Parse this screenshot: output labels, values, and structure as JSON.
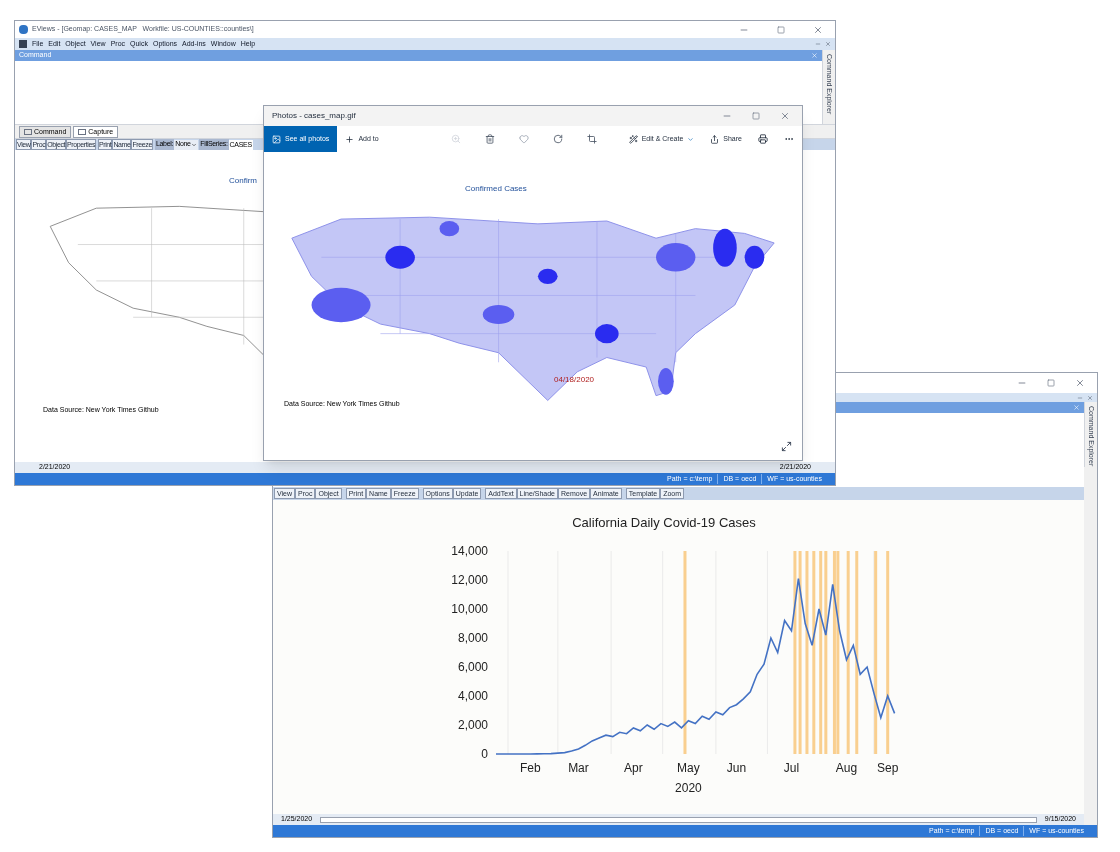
{
  "eviews_window": {
    "title": "EViews - [Geomap: CASES_MAP   Workfile: US-COUNTIES::counties\\]",
    "menu": [
      "File",
      "Edit",
      "Object",
      "View",
      "Proc",
      "Quick",
      "Options",
      "Add-ins",
      "Window",
      "Help"
    ],
    "command_pane": {
      "title": "Command",
      "side_tab": "Command Explorer"
    },
    "tabs": [
      {
        "label": "Command",
        "selected": false
      },
      {
        "label": "Capture",
        "selected": true
      }
    ],
    "toolbar": [
      [
        "View",
        "Proc",
        "Object",
        "Properties"
      ],
      [
        "Print",
        "Name",
        "Freeze"
      ]
    ],
    "label_field": {
      "label": "Label:",
      "value": "None"
    },
    "fill_series": {
      "label": "FillSeries:",
      "value": "CASES"
    },
    "map": {
      "title": "Confirm",
      "source": "Data Source: New York Times Github"
    },
    "date_start": "2/21/2020",
    "date_end": "2/21/2020",
    "status": [
      "Path = c:\\temp",
      "DB = oecd",
      "WF = us-counties"
    ]
  },
  "photos_window": {
    "title": "Photos - cases_map.gif",
    "see_all": "See all photos",
    "add_to": "Add to",
    "edit_create": "Edit & Create",
    "share": "Share",
    "image": {
      "title": "Confirmed Cases",
      "date": "04/18/2020",
      "source": "Data Source: New York Times Github"
    }
  },
  "chart_window": {
    "side_tab": "Command Explorer",
    "toolbar": [
      [
        "View",
        "Proc",
        "Object"
      ],
      [
        "Print",
        "Name",
        "Freeze"
      ],
      [
        "Options",
        "Update"
      ],
      [
        "AddText",
        "Line/Shade",
        "Remove",
        "Animate"
      ],
      [
        "Template",
        "Zoom"
      ]
    ],
    "chart_data": {
      "type": "line",
      "title": "California Daily Covid-19 Cases",
      "xlabel": "2020",
      "categories": [
        null,
        null,
        null,
        null,
        null,
        "Feb",
        null,
        null,
        null,
        null,
        null,
        null,
        "Mar",
        null,
        null,
        null,
        null,
        null,
        null,
        null,
        "Apr",
        null,
        null,
        null,
        null,
        null,
        null,
        null,
        "May",
        null,
        null,
        null,
        null,
        null,
        null,
        "Jun",
        null,
        null,
        null,
        null,
        null,
        null,
        null,
        "Jul",
        null,
        null,
        null,
        null,
        null,
        null,
        null,
        "Aug",
        null,
        null,
        null,
        null,
        null,
        "Sep",
        null
      ],
      "series": [
        {
          "color": "#4472c4",
          "values": [
            0,
            0,
            0,
            0,
            0,
            0,
            10,
            20,
            30,
            60,
            100,
            200,
            350,
            600,
            900,
            1100,
            1300,
            1200,
            1500,
            1400,
            1800,
            1600,
            2000,
            1700,
            2100,
            1900,
            2200,
            1800,
            2300,
            2100,
            2600,
            2400,
            2900,
            2700,
            3200,
            3400,
            3800,
            4300,
            5500,
            6200,
            8000,
            7000,
            9200,
            8500,
            12100,
            9000,
            7500,
            10000,
            8200,
            11700,
            8500,
            6500,
            7500,
            5500,
            6000,
            4200,
            2500,
            4000,
            2800
          ]
        }
      ],
      "ylim": [
        0,
        14000
      ],
      "yticks": [
        {
          "value": 0,
          "label": "0"
        },
        {
          "value": 2000,
          "label": "2,000"
        },
        {
          "value": 4000,
          "label": "4,000"
        },
        {
          "value": 6000,
          "label": "6,000"
        },
        {
          "value": 8000,
          "label": "8,000"
        },
        {
          "value": 10000,
          "label": "10,000"
        },
        {
          "value": 12000,
          "label": "12,000"
        },
        {
          "value": 14000,
          "label": "14,000"
        }
      ]
    },
    "date_start": "1/25/2020",
    "date_end": "9/15/2020",
    "status": [
      "Path = c:\\temp",
      "DB = oecd",
      "WF = us-counties"
    ]
  }
}
